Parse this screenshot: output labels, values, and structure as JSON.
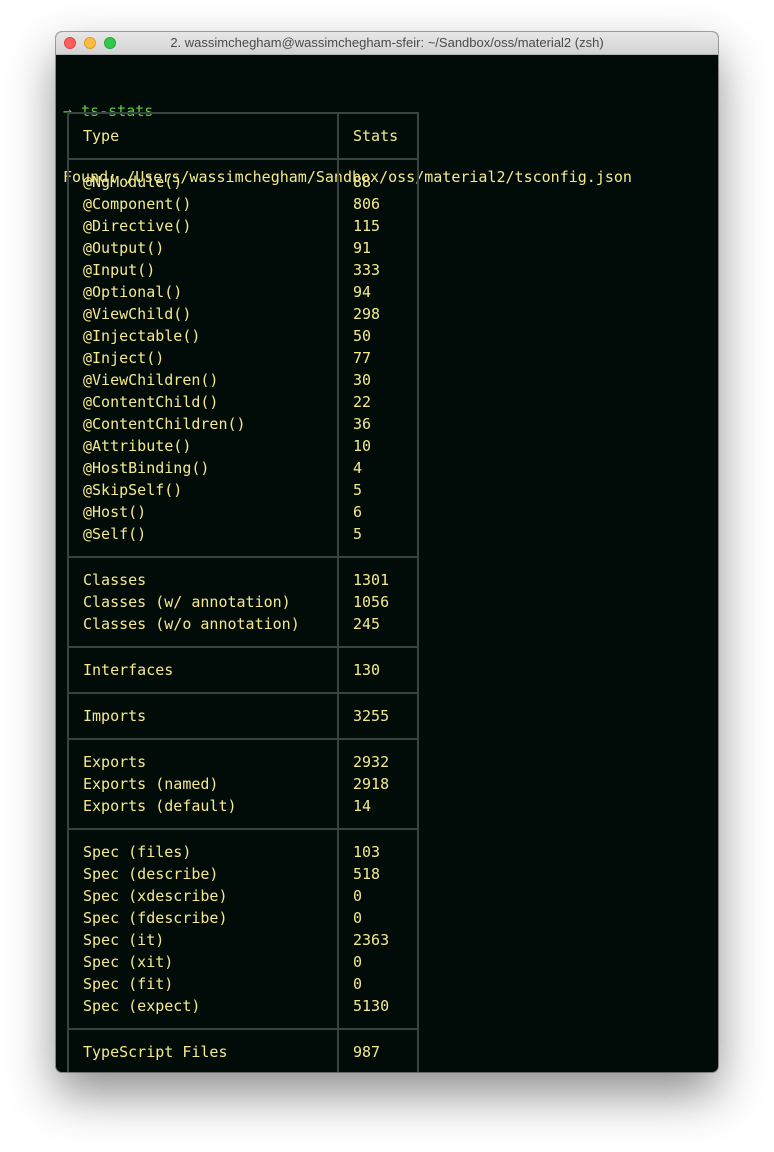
{
  "window": {
    "title": "2. wassimchegham@wassimchegham-sfeir: ~/Sandbox/oss/material2 (zsh)",
    "colors": {
      "background": "#010c09",
      "text": "#f7e98a",
      "prompt": "#64cc3c",
      "header": "#e8333b",
      "border": "#384441"
    }
  },
  "terminal": {
    "prompt_symbol": "→",
    "command": "ts-stats",
    "found_line": "Found: /Users/wassimchegham/Sandbox/oss/material2/tsconfig.json"
  },
  "table": {
    "header": {
      "type": "Type",
      "stats": "Stats"
    },
    "sections": [
      {
        "rows": [
          {
            "label": "@NgModule()",
            "value": "88"
          },
          {
            "label": "@Component()",
            "value": "806"
          },
          {
            "label": "@Directive()",
            "value": "115"
          },
          {
            "label": "@Output()",
            "value": "91"
          },
          {
            "label": "@Input()",
            "value": "333"
          },
          {
            "label": "@Optional()",
            "value": "94"
          },
          {
            "label": "@ViewChild()",
            "value": "298"
          },
          {
            "label": "@Injectable()",
            "value": "50"
          },
          {
            "label": "@Inject()",
            "value": "77"
          },
          {
            "label": "@ViewChildren()",
            "value": "30"
          },
          {
            "label": "@ContentChild()",
            "value": "22"
          },
          {
            "label": "@ContentChildren()",
            "value": "36"
          },
          {
            "label": "@Attribute()",
            "value": "10"
          },
          {
            "label": "@HostBinding()",
            "value": "4"
          },
          {
            "label": "@SkipSelf()",
            "value": "5"
          },
          {
            "label": "@Host()",
            "value": "6"
          },
          {
            "label": "@Self()",
            "value": "5"
          }
        ]
      },
      {
        "rows": [
          {
            "label": "Classes",
            "value": "1301"
          },
          {
            "label": "Classes (w/ annotation)",
            "value": "1056"
          },
          {
            "label": "Classes (w/o annotation)",
            "value": "245"
          }
        ]
      },
      {
        "rows": [
          {
            "label": "Interfaces",
            "value": "130"
          }
        ]
      },
      {
        "rows": [
          {
            "label": "Imports",
            "value": "3255"
          }
        ]
      },
      {
        "rows": [
          {
            "label": "Exports",
            "value": "2932"
          },
          {
            "label": "Exports (named)",
            "value": "2918"
          },
          {
            "label": "Exports (default)",
            "value": "14"
          }
        ]
      },
      {
        "rows": [
          {
            "label": "Spec (files)",
            "value": "103"
          },
          {
            "label": "Spec (describe)",
            "value": "518"
          },
          {
            "label": "Spec (xdescribe)",
            "value": "0"
          },
          {
            "label": "Spec (fdescribe)",
            "value": "0"
          },
          {
            "label": "Spec (it)",
            "value": "2363"
          },
          {
            "label": "Spec (xit)",
            "value": "0"
          },
          {
            "label": "Spec (fit)",
            "value": "0"
          },
          {
            "label": "Spec (expect)",
            "value": "5130"
          }
        ]
      },
      {
        "rows": [
          {
            "label": "TypeScript Files",
            "value": "987"
          }
        ]
      }
    ]
  }
}
